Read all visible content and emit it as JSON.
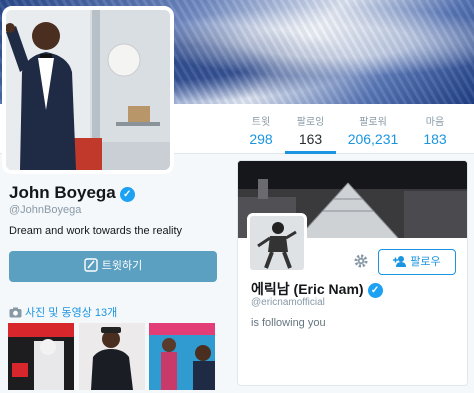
{
  "stats": [
    {
      "label": "트윗",
      "value": "298"
    },
    {
      "label": "팔로잉",
      "value": "163"
    },
    {
      "label": "팔로워",
      "value": "206,231"
    },
    {
      "label": "마음",
      "value": "183"
    }
  ],
  "profile": {
    "name": "John Boyega",
    "handle": "@JohnBoyega",
    "bio": "Dream and work towards the reality",
    "tweet_button": "트윗하기",
    "photos_label": "사진 및 동영상 13개"
  },
  "card": {
    "name": "에릭남 (Eric Nam)",
    "handle": "@ericnamofficial",
    "status": "is following you",
    "follow_label": "팔로우"
  },
  "colors": {
    "accent": "#1b95e0",
    "tweet_button": "#5b9fc1",
    "verified": "#1da1f2"
  },
  "icons": [
    "verified-badge-icon",
    "compose-icon",
    "camera-icon",
    "gear-icon",
    "add-person-icon"
  ]
}
